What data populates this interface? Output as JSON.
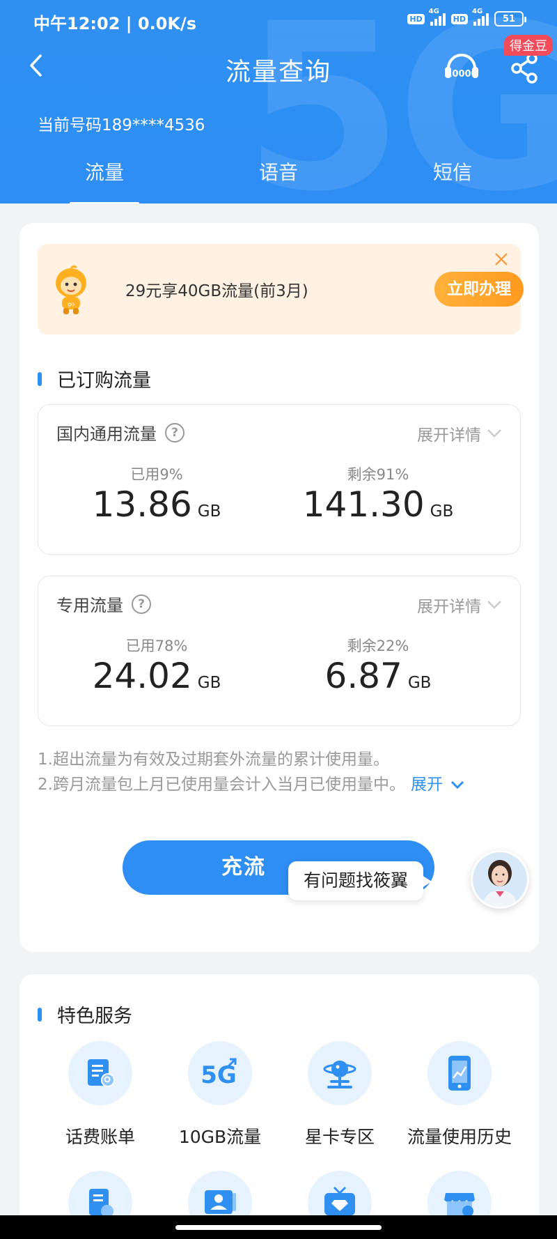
{
  "status_bar": {
    "time": "中午12:02 | 0.0K/s",
    "hd1": "HD",
    "net1": "4G",
    "hd2": "HD",
    "net2": "4G",
    "battery": "51"
  },
  "header": {
    "title": "流量查询",
    "coin_badge": "得金豆",
    "cs_icon": "10000-service-icon",
    "phone_line": "当前号码189****4536",
    "tabs": [
      {
        "label": "流量",
        "active": true
      },
      {
        "label": "语音",
        "active": false
      },
      {
        "label": "短信",
        "active": false
      }
    ]
  },
  "promo": {
    "text": "29元享40GB流量(前3月)",
    "button": "立即办理"
  },
  "subscribed": {
    "title": "已订购流量",
    "items": [
      {
        "name": "国内通用流量",
        "expand": "展开详情",
        "used_label": "已用9%",
        "used_value": "13.86",
        "remain_label": "剩余91%",
        "remain_value": "141.30",
        "unit": "GB"
      },
      {
        "name": "专用流量",
        "expand": "展开详情",
        "used_label": "已用78%",
        "used_value": "24.02",
        "remain_label": "剩余22%",
        "remain_value": "6.87",
        "unit": "GB"
      }
    ],
    "help_glyph": "?"
  },
  "notes": {
    "line1": "1.超出流量为有效及过期套外流量的累计使用量。",
    "line2": "2.跨月流量包上月已使用量会计入当月已使用量中。",
    "expand": "展开"
  },
  "recharge_button": "充流",
  "helper": {
    "bubble": "有问题找筱翼"
  },
  "services": {
    "title": "特色服务",
    "items": [
      {
        "label": "话费账单",
        "icon": "bill-icon"
      },
      {
        "label": "10GB流量",
        "icon": "5g-icon"
      },
      {
        "label": "星卡专区",
        "icon": "planet-icon"
      },
      {
        "label": "流量使用历史",
        "icon": "phone-chart-icon"
      }
    ]
  },
  "colors": {
    "primary": "#2e8ef4",
    "promo_bg": "#fff2e3",
    "promo_btn": "#ff9a1e",
    "badge": "#f24b5a"
  }
}
